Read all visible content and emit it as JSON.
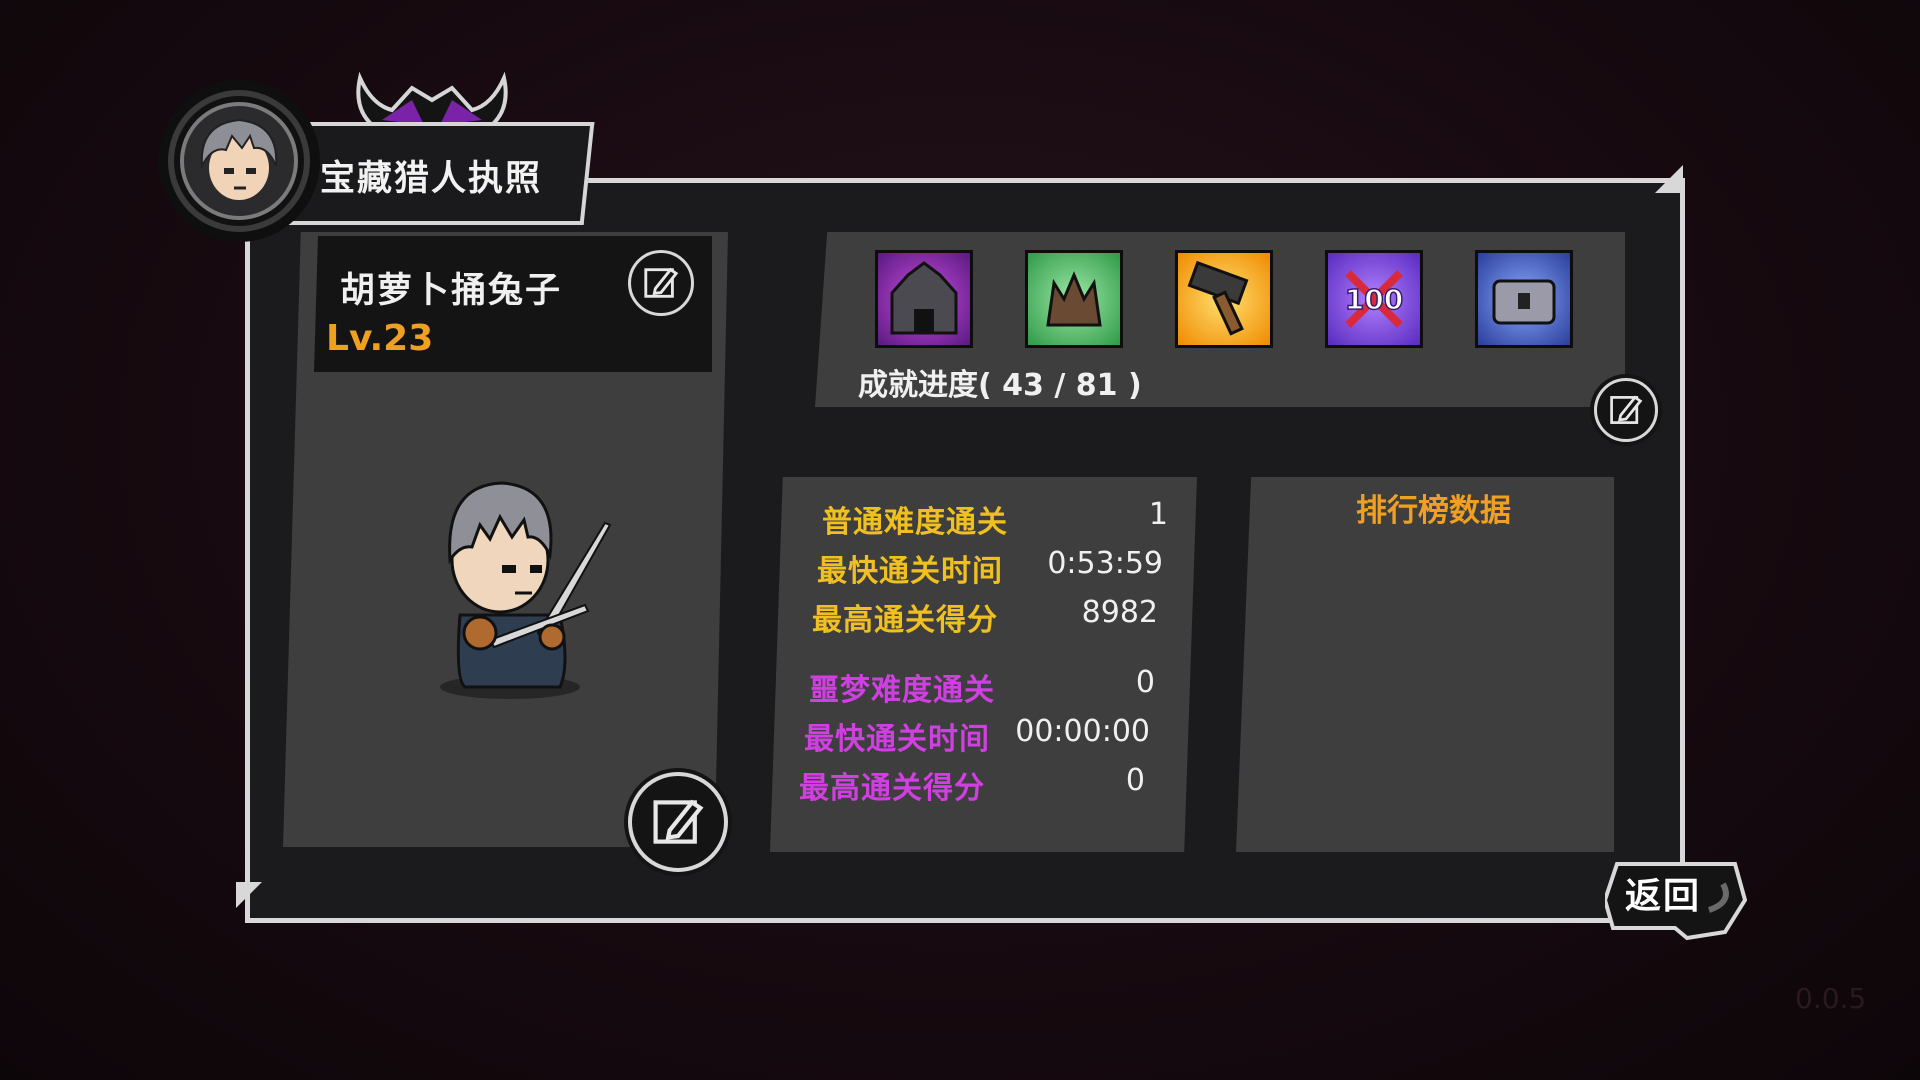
{
  "header": {
    "title": "宝藏猎人执照"
  },
  "profile": {
    "name": "胡萝卜捅兔子",
    "level": "Lv.23"
  },
  "achievements": {
    "progress_label": "成就进度( 43 / 81 )",
    "icons": [
      {
        "name": "dark-castle-icon",
        "bg": "#8a2fb0"
      },
      {
        "name": "tree-stump-icon",
        "bg": "#3fae54"
      },
      {
        "name": "hammer-icon",
        "bg": "#f0a800"
      },
      {
        "name": "hundred-icon",
        "bg": "#7a3ad8"
      },
      {
        "name": "treasure-chest-icon",
        "bg": "#3a5ec8"
      }
    ]
  },
  "stats": {
    "normal": {
      "clears_label": "普通难度通关",
      "clears_value": "1",
      "fastest_label": "最快通关时间",
      "fastest_value": "0:53:59",
      "score_label": "最高通关得分",
      "score_value": "8982"
    },
    "nightmare": {
      "clears_label": "噩梦难度通关",
      "clears_value": "0",
      "fastest_label": "最快通关时间",
      "fastest_value": "00:00:00",
      "score_label": "最高通关得分",
      "score_value": "0"
    }
  },
  "leaderboard": {
    "title": "排行榜数据"
  },
  "back": {
    "label": "返回"
  },
  "version": "0.0.5",
  "colors": {
    "accent_orange": "#f0a020",
    "normal_yellow": "#f0c020",
    "nightmare_purple": "#d040e0"
  }
}
